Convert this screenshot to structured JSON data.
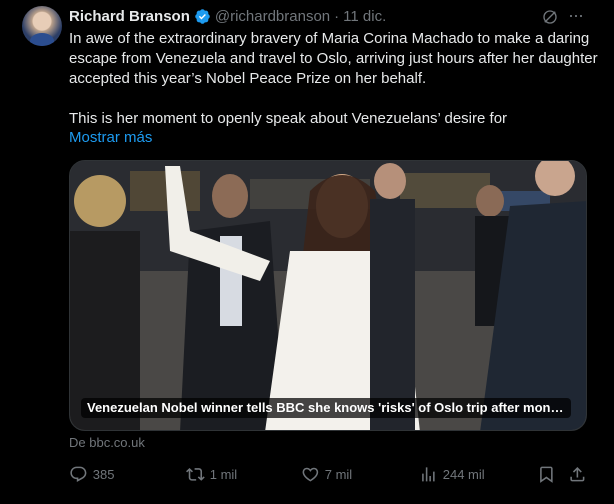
{
  "tweet": {
    "author_name": "Richard Branson",
    "handle": "@richardbranson",
    "separator": "·",
    "date": "11 dic.",
    "text_para1": "In awe of the extraordinary bravery of Maria Corina Machado to make a daring escape from Venezuela and travel to Oslo, arriving just hours after her daughter accepted this year’s Nobel Peace Prize on her behalf.",
    "text_para2": "This is her moment to openly speak about Venezuelans’ desire for",
    "show_more": "Mostrar más"
  },
  "card": {
    "caption": "Venezuelan Nobel winner tells BBC she knows 'risks' of Oslo trip after months i...",
    "source": "De bbc.co.uk"
  },
  "actions": {
    "reply_count": "385",
    "retweet_count": "1 mil",
    "like_count": "7 mil",
    "views_count": "244 mil"
  },
  "colors": {
    "background": "#000000",
    "text": "#e7e9ea",
    "muted": "#71767b",
    "link": "#1d9bf0",
    "verified": "#1d9bf0"
  },
  "icons": [
    "verified-badge-icon",
    "grok-icon",
    "more-icon",
    "reply-icon",
    "retweet-icon",
    "like-icon",
    "views-icon",
    "bookmark-icon",
    "share-icon"
  ]
}
